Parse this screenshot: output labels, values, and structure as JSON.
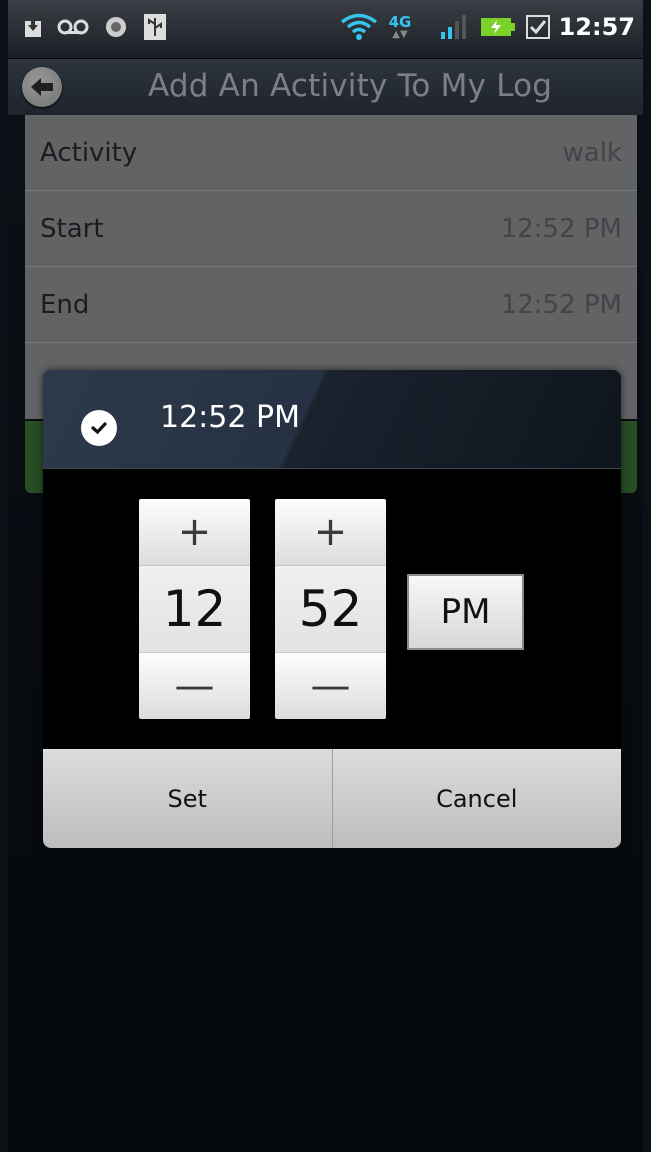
{
  "status_bar": {
    "time": "12:57",
    "network": "4G",
    "icons": [
      "download-icon",
      "voicemail-icon",
      "circle-icon",
      "usb-icon",
      "wifi-icon",
      "4g-icon",
      "signal-icon",
      "battery-charging-icon",
      "checkbox-icon"
    ]
  },
  "header": {
    "title": "Add An Activity To My Log"
  },
  "form": {
    "rows": [
      {
        "label": "Activity",
        "value": "walk"
      },
      {
        "label": "Start",
        "value": "12:52 PM"
      },
      {
        "label": "End",
        "value": "12:52 PM"
      }
    ]
  },
  "dialog": {
    "title": "12:52 PM",
    "hour": "12",
    "minute": "52",
    "plus_symbol": "+",
    "minus_symbol": "—",
    "ampm": "PM",
    "set_label": "Set",
    "cancel_label": "Cancel"
  }
}
